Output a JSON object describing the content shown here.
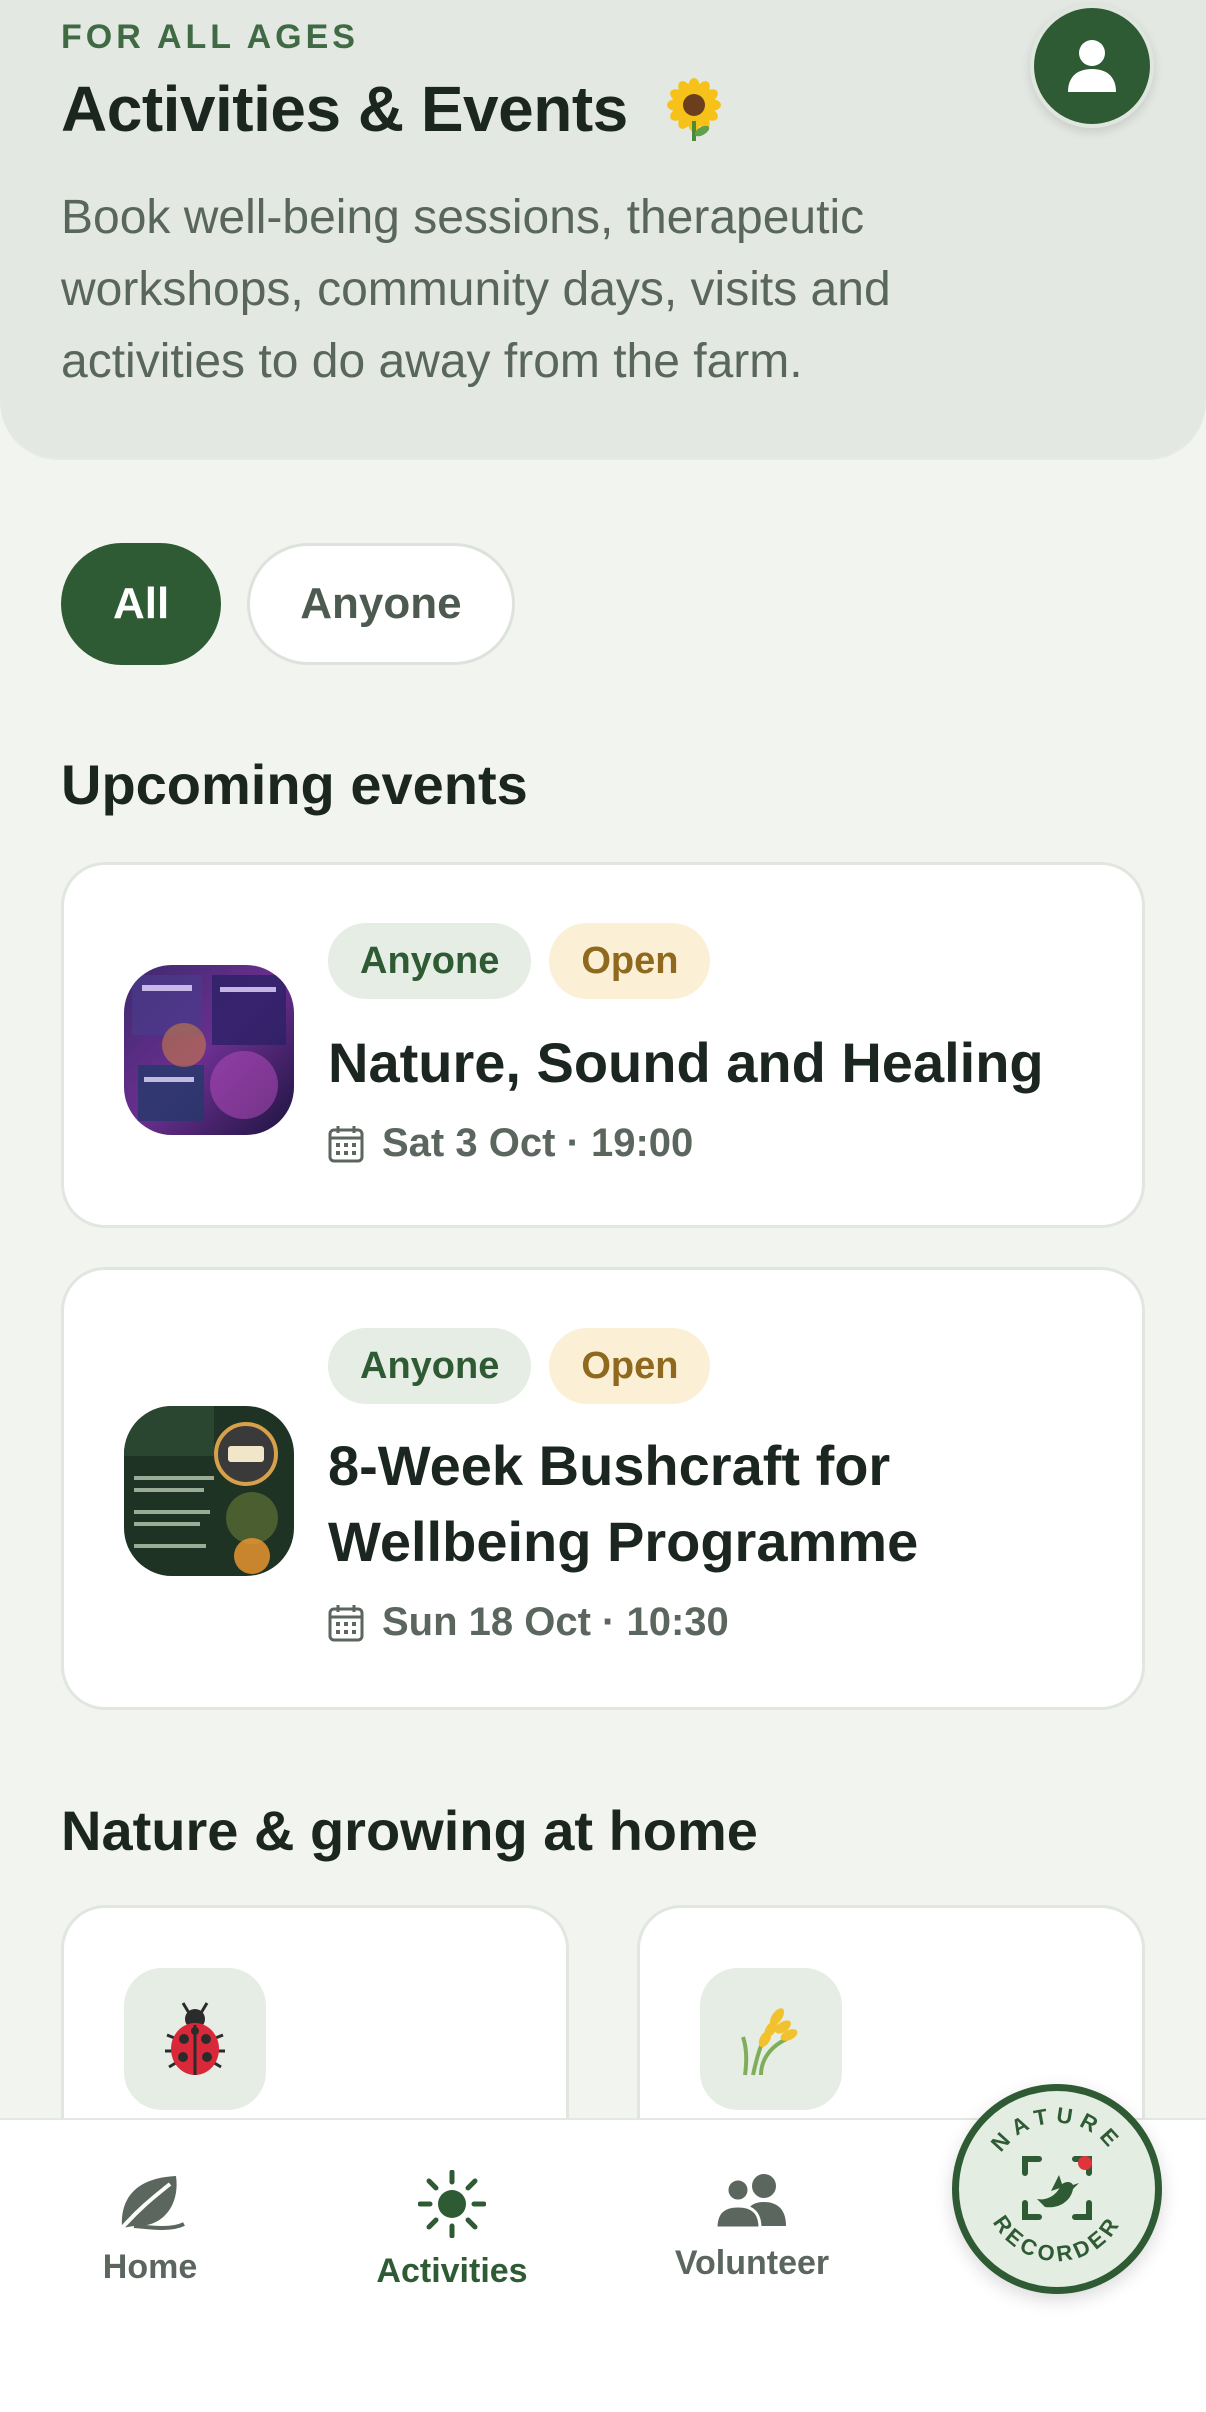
{
  "header": {
    "eyebrow": "FOR ALL AGES",
    "title": "Activities & Events",
    "title_emoji": "sunflower-icon",
    "subtitle": "Book well-being sessions, therapeutic workshops, community days, visits and activities to do away from the farm.",
    "profile_icon": "user-icon"
  },
  "filters": {
    "chips": [
      {
        "label": "All",
        "selected": true
      },
      {
        "label": "Anyone",
        "selected": false
      }
    ]
  },
  "upcoming": {
    "title": "Upcoming events",
    "events": [
      {
        "tags": [
          "Anyone",
          "Open"
        ],
        "title": "Nature, Sound and Healing",
        "date": "Sat 3 Oct · 19:00"
      },
      {
        "tags": [
          "Anyone",
          "Open"
        ],
        "title": "8-Week Bushcraft for Wellbeing Programme",
        "date": "Sun 18 Oct · 10:30"
      }
    ]
  },
  "nature": {
    "title": "Nature & growing at home",
    "cards": [
      {
        "icon": "ladybird-icon"
      },
      {
        "icon": "wheat-icon"
      }
    ]
  },
  "nav": {
    "items": [
      {
        "label": "Home",
        "icon": "leaf-icon",
        "active": false
      },
      {
        "label": "Activities",
        "icon": "sun-icon",
        "active": true
      },
      {
        "label": "Volunteer",
        "icon": "people-icon",
        "active": false
      }
    ],
    "recorder": {
      "line1": "NATURE",
      "line2": "RECORDER",
      "icon": "bird-scan-icon"
    }
  },
  "colors": {
    "brand_green": "#2f5b34",
    "background": "#f2f4ef",
    "header_bg": "#e4e8e3",
    "open_badge_bg": "#fbf0d6",
    "open_badge_text": "#8f6a1e"
  }
}
